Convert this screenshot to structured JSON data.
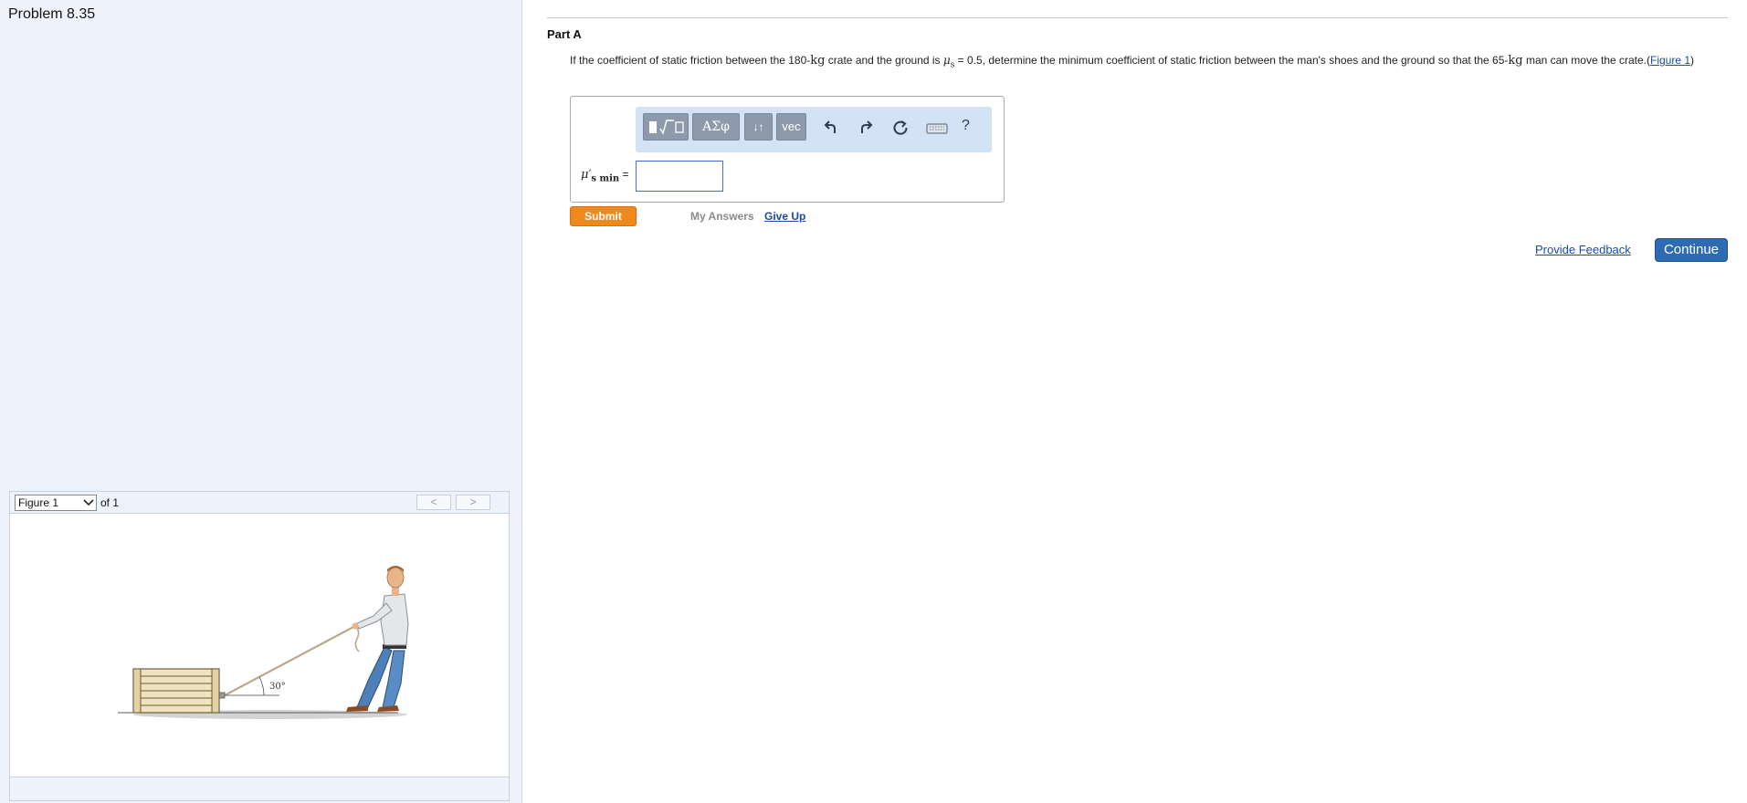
{
  "problem": {
    "title": "Problem 8.35"
  },
  "figure_viewer": {
    "selected": "Figure 1",
    "of_text": "of 1",
    "prev_glyph": "<",
    "next_glyph": ">",
    "angle_label": "30°"
  },
  "part": {
    "title": "Part A",
    "question": {
      "t1": "If the coefficient of static friction between the 180-",
      "kg1": "kg",
      "t2": " crate and the ground is ",
      "mu": "μ",
      "mu_sub": "s",
      "t3": " = 0.5, determine the minimum coefficient of static friction between the man's shoes and the ground so that the 65-",
      "kg2": "kg",
      "t4": " man can move the crate.",
      "link_open": "(",
      "link_text": "Figure 1",
      "link_close": ")"
    }
  },
  "math_toolbar": {
    "greek_label": "ΑΣφ",
    "arrows_label": "↓↑",
    "vec_label": "vec",
    "help_label": "?"
  },
  "answer": {
    "label_mu": "μ′",
    "label_sub": "s min",
    "label_eq": " =",
    "value": ""
  },
  "actions": {
    "submit": "Submit",
    "my_answers": "My Answers",
    "give_up": "Give Up",
    "provide_feedback": "Provide Feedback",
    "continue": "Continue"
  },
  "colors": {
    "submit_orange": "#f0891c",
    "continue_blue": "#2f6bb4",
    "link_blue": "#1a4ba6",
    "panel_bg": "#eef3fb",
    "toolbar_bg": "#d3e3f5"
  }
}
